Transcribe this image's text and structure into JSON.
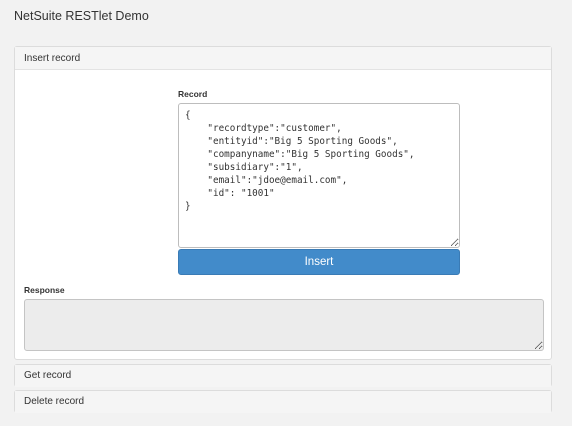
{
  "app": {
    "title": "NetSuite RESTlet Demo"
  },
  "panels": {
    "insert": {
      "heading": "Insert record",
      "record_label": "Record",
      "record_value": "{\n    \"recordtype\":\"customer\",\n    \"entityid\":\"Big 5 Sporting Goods\",\n    \"companyname\":\"Big 5 Sporting Goods\",\n    \"subsidiary\":\"1\",\n    \"email\":\"jdoe@email.com\",\n    \"id\": \"1001\"\n}",
      "insert_label": "Insert",
      "response_label": "Response",
      "response_value": ""
    },
    "get": {
      "heading": "Get record"
    },
    "delete": {
      "heading": "Delete record"
    }
  },
  "colors": {
    "primary_button": "#428bca",
    "page_background": "#f2f2f2"
  }
}
